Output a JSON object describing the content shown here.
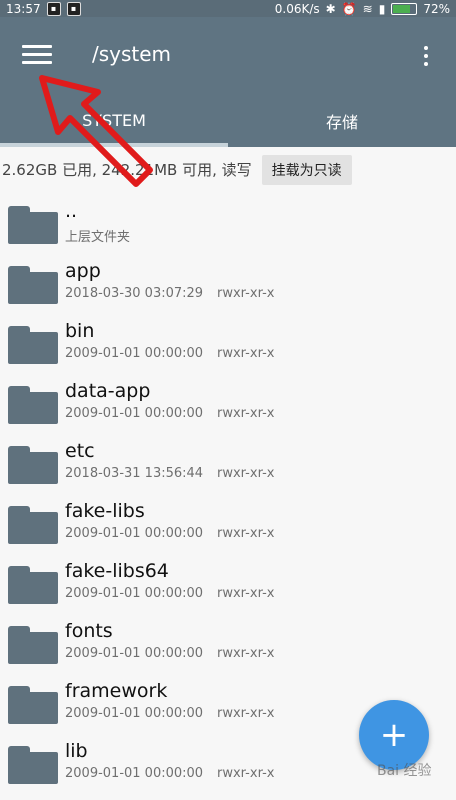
{
  "status_bar": {
    "time": "13:57",
    "speed": "0.06K/s",
    "battery": "72%"
  },
  "appbar": {
    "title": "/system"
  },
  "tabs": [
    {
      "label": "SYSTEM",
      "active": true
    },
    {
      "label": "存储",
      "active": false
    }
  ],
  "storage": {
    "info": "2.62GB 已用, 242.21MB 可用, 读写",
    "mount_button": "挂载为只读"
  },
  "files": [
    {
      "name": "..",
      "date": "上层文件夹",
      "perm": ""
    },
    {
      "name": "app",
      "date": "2018-03-30 03:07:29",
      "perm": "rwxr-xr-x"
    },
    {
      "name": "bin",
      "date": "2009-01-01 00:00:00",
      "perm": "rwxr-xr-x"
    },
    {
      "name": "data-app",
      "date": "2009-01-01 00:00:00",
      "perm": "rwxr-xr-x"
    },
    {
      "name": "etc",
      "date": "2018-03-31 13:56:44",
      "perm": "rwxr-xr-x"
    },
    {
      "name": "fake-libs",
      "date": "2009-01-01 00:00:00",
      "perm": "rwxr-xr-x"
    },
    {
      "name": "fake-libs64",
      "date": "2009-01-01 00:00:00",
      "perm": "rwxr-xr-x"
    },
    {
      "name": "fonts",
      "date": "2009-01-01 00:00:00",
      "perm": "rwxr-xr-x"
    },
    {
      "name": "framework",
      "date": "2009-01-01 00:00:00",
      "perm": "rwxr-xr-x"
    },
    {
      "name": "lib",
      "date": "2009-01-01 00:00:00",
      "perm": "rwxr-xr-x"
    }
  ],
  "fab": {
    "icon": "plus-icon",
    "label": "+"
  },
  "watermark": "Bai 经验",
  "colors": {
    "appbar": "#5f7482",
    "folder": "#5f717d",
    "fab": "#3f95e3",
    "arrow": "#e01b1b"
  }
}
